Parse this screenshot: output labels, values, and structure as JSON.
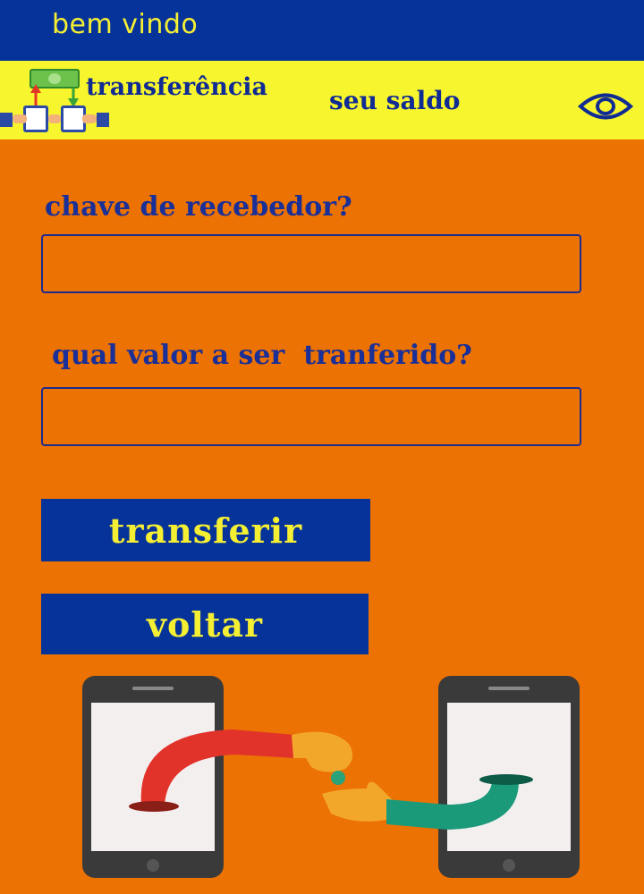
{
  "header": {
    "welcome": "bem vindo"
  },
  "nav": {
    "transfer_label": "transferência",
    "balance_label": "seu saldo",
    "transfer_icon": "money-transfer-icon",
    "eye_icon": "eye-icon"
  },
  "form": {
    "receiver_label": "chave de recebedor?",
    "receiver_value": "",
    "amount_label": "qual valor a ser  tranferido?",
    "amount_value": ""
  },
  "buttons": {
    "transfer": "transferir",
    "back": "voltar"
  },
  "illustration": "phone-to-phone-payment-illustration",
  "colors": {
    "topbar": "#06339a",
    "subbar": "#f7f52d",
    "background": "#ec7203",
    "text_yellow": "#f5ef33",
    "text_blue": "#1a2f97"
  }
}
